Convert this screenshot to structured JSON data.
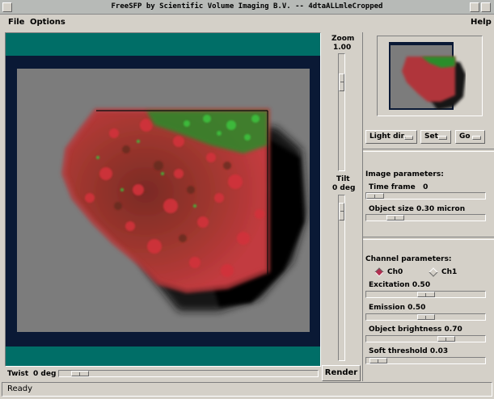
{
  "window": {
    "title": "FreeSFP by Scientific Volume Imaging B.V. -- 4dtaALLmleCropped"
  },
  "menu": {
    "file": "File",
    "options": "Options",
    "help": "Help"
  },
  "zoom": {
    "label": "Zoom",
    "value": "1.00",
    "level": 0.2
  },
  "tilt": {
    "label": "Tilt",
    "value": "0 deg",
    "level": 0.05
  },
  "twist": {
    "label": "Twist",
    "value": "0 deg",
    "level": 0.05
  },
  "render_button": "Render",
  "status": "Ready",
  "controls": {
    "light_dir": "Light dir.",
    "set": "Set",
    "go": "Go"
  },
  "image_parameters": {
    "heading": "Image parameters:",
    "time_frame_label": "Time frame",
    "time_frame_value": "0",
    "time_frame_level": 0.0,
    "object_size_label": "Object size",
    "object_size_value": "0.30 micron",
    "object_size_level": 0.2
  },
  "channel_parameters": {
    "heading": "Channel parameters:",
    "channels": [
      "Ch0",
      "Ch1"
    ],
    "selected_channel": "Ch0",
    "excitation_label": "Excitation",
    "excitation_value": "0.50",
    "excitation_level": 0.5,
    "emission_label": "Emission",
    "emission_value": "0.50",
    "emission_level": 0.5,
    "brightness_label": "Object brightness",
    "brightness_value": "0.70",
    "brightness_level": 0.7,
    "threshold_label": "Soft threshold",
    "threshold_value": "0.03",
    "threshold_level": 0.03
  },
  "colors": {
    "background": "#d4d0c8",
    "viewport_frame": "#0a1935",
    "teal_band": "#006e67",
    "render_gray": "#7c7c7c",
    "channel_red": "#c0282d",
    "channel_green": "#2fa02f"
  }
}
